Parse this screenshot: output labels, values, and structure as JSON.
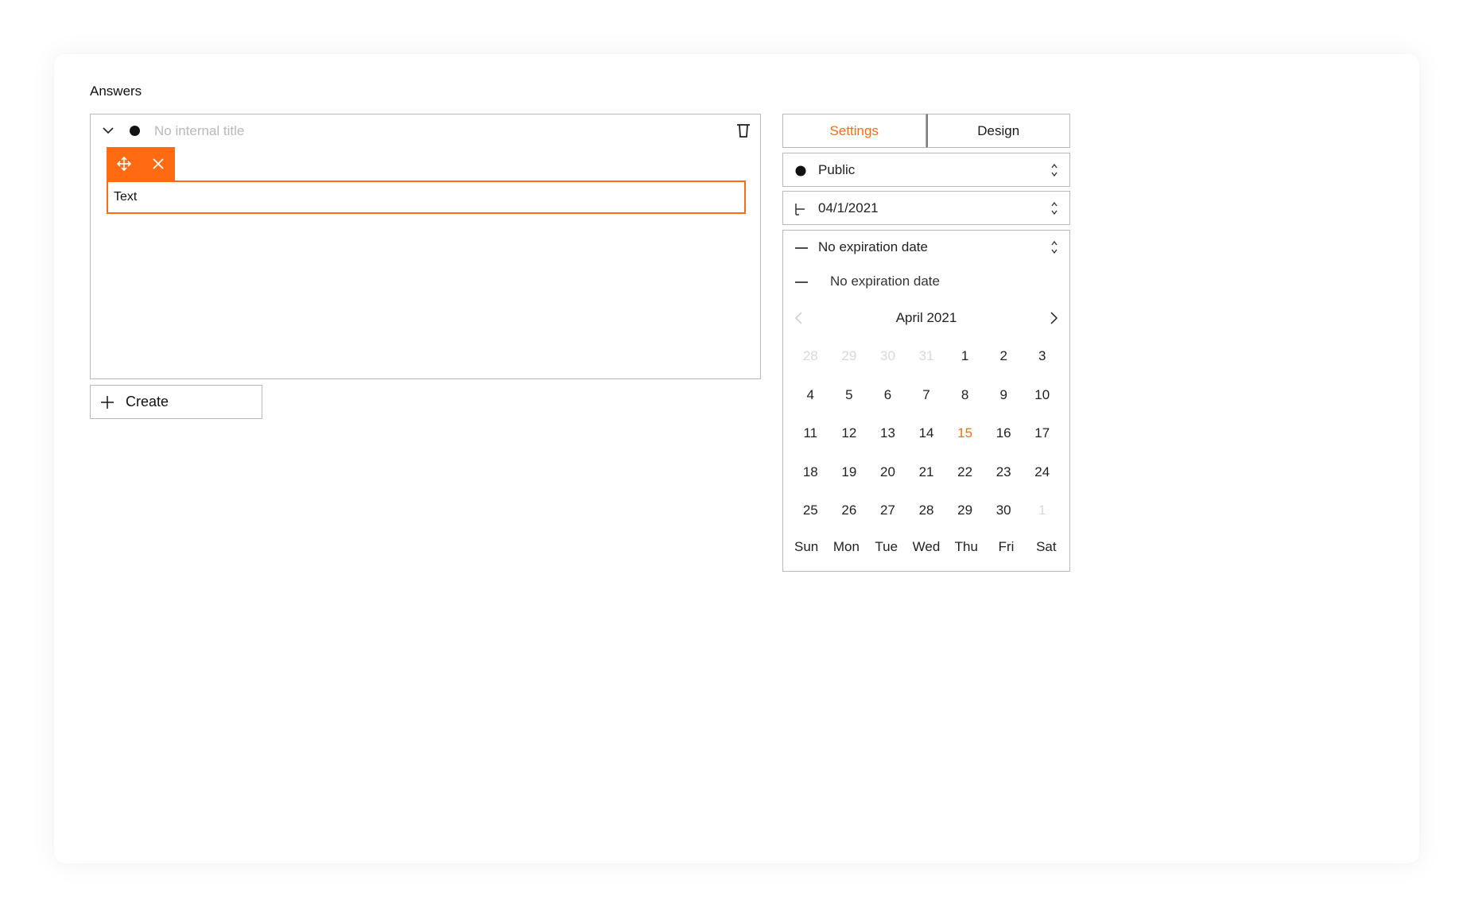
{
  "section_label": "Answers",
  "answer": {
    "internal_title_placeholder": "No internal title",
    "text_value": "Text"
  },
  "create_label": "Create",
  "tabs": [
    {
      "label": "Settings",
      "active": true
    },
    {
      "label": "Design",
      "active": false
    }
  ],
  "visibility": {
    "value": "Public"
  },
  "start_date": {
    "value": "04/1/2021"
  },
  "expiration": {
    "value": "No expiration date",
    "option": "No expiration date"
  },
  "calendar": {
    "month_label": "April 2021",
    "weeks": [
      [
        {
          "d": "28",
          "other": true
        },
        {
          "d": "29",
          "other": true
        },
        {
          "d": "30",
          "other": true
        },
        {
          "d": "31",
          "other": true
        },
        {
          "d": "1"
        },
        {
          "d": "2"
        },
        {
          "d": "3"
        }
      ],
      [
        {
          "d": "4"
        },
        {
          "d": "5"
        },
        {
          "d": "6"
        },
        {
          "d": "7"
        },
        {
          "d": "8"
        },
        {
          "d": "9"
        },
        {
          "d": "10"
        }
      ],
      [
        {
          "d": "11"
        },
        {
          "d": "12"
        },
        {
          "d": "13"
        },
        {
          "d": "14"
        },
        {
          "d": "15",
          "today": true
        },
        {
          "d": "16"
        },
        {
          "d": "17"
        }
      ],
      [
        {
          "d": "18"
        },
        {
          "d": "19"
        },
        {
          "d": "20"
        },
        {
          "d": "21"
        },
        {
          "d": "22"
        },
        {
          "d": "23"
        },
        {
          "d": "24"
        }
      ],
      [
        {
          "d": "25"
        },
        {
          "d": "26"
        },
        {
          "d": "27"
        },
        {
          "d": "28"
        },
        {
          "d": "29"
        },
        {
          "d": "30"
        },
        {
          "d": "1",
          "other": true
        }
      ]
    ],
    "weekdays": [
      "Sun",
      "Mon",
      "Tue",
      "Wed",
      "Thu",
      "Fri",
      "Sat"
    ]
  },
  "colors": {
    "accent": "#ff6a13",
    "border": "#b9b9b9",
    "muted_text": "#b9b9b9"
  },
  "icons": {
    "collapse": "chevron-down-icon",
    "status": "dot-icon",
    "delete": "trash-icon",
    "move": "move-icon",
    "remove": "close-icon",
    "create": "plus-icon",
    "start": "start-bracket-icon",
    "expiration": "dash-icon",
    "select": "up-down-icon",
    "prev_month": "chevron-left-icon",
    "next_month": "chevron-right-icon"
  }
}
